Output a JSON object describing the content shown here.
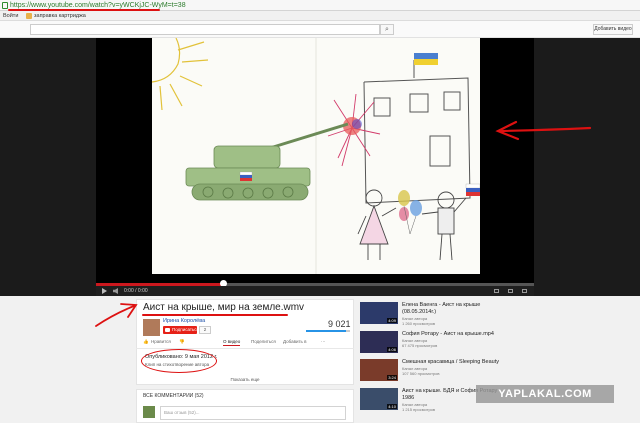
{
  "browser": {
    "url": "https://www.youtube.com/watch?v=yWCKjJC-WyM=t=38",
    "bookmarks_left": "Войти",
    "bookmark_item": "заправка картриджа"
  },
  "header": {
    "search_placeholder": "",
    "upload_label": "Добавить видео"
  },
  "player": {
    "time": "0:00 / 0:00",
    "progress_fraction": 0.29
  },
  "video": {
    "title": "Аист на крыше, мир на земле.wmv",
    "author": "Ирина Королёва",
    "subscribe_label": "Подписаться",
    "subscriber_count": "2",
    "views": "9 021",
    "like_fraction": 0.9,
    "tabs": [
      "👍",
      "Нравится",
      "👎",
      "О видео",
      "Поделиться",
      "Добавить в",
      "⋯"
    ],
    "published": "Опубликовано: 9 мая 2012 г.",
    "description": "Клип на стихотворение автора",
    "show_more": "Показать еще"
  },
  "comments": {
    "header": "ВСЕ КОММЕНТАРИИ (52)",
    "placeholder": "Ваш отзыв (52)..."
  },
  "sidebar": [
    {
      "title": "Елена Ваенга - Аист на крыше",
      "title2": "(08.05.2014г.)",
      "meta1": "Канал автора",
      "meta2": "1 260 просмотров",
      "duration": "4:09",
      "color": "#2c3a6a"
    },
    {
      "title": "София Ротару - Аист на крыше.mp4",
      "title2": "",
      "meta1": "Канал автора",
      "meta2": "67 475 просмотров",
      "duration": "4:06",
      "color": "#2d2d55"
    },
    {
      "title": "Смешная красавица / Sleeping Beauty",
      "title2": "",
      "meta1": "Канал автора",
      "meta2": "107 560 просмотров",
      "duration": "3:24",
      "color": "#7a3b2a"
    },
    {
      "title": "Аист на крыше. БДЯ и София Ротару",
      "title2": "1986",
      "meta1": "Канал автора",
      "meta2": "1 215 просмотров",
      "duration": "4:10",
      "color": "#3a4d6a"
    }
  ],
  "watermark": "YAPLAKAL.COM",
  "colors": {
    "annotation_red": "#dd1111",
    "yt_red": "#e62117",
    "link_blue": "#1a4ea8"
  }
}
